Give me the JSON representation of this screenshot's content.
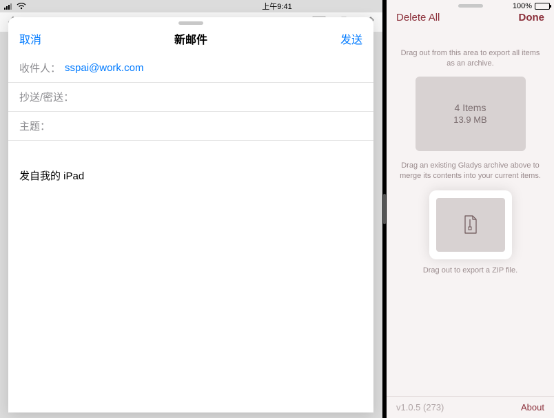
{
  "statusbar": {
    "time": "上午9:41",
    "battery_pct": "100%"
  },
  "compose": {
    "cancel": "取消",
    "title": "新邮件",
    "send": "发送",
    "to_label": "收件人：",
    "to_value": "sspai@work.com",
    "cc_label": "抄送/密送：",
    "subject_label": "主题：",
    "body_text": "发自我的 iPad"
  },
  "right": {
    "delete_all": "Delete All",
    "done": "Done",
    "hint_export": "Drag out from this area to export all items as an archive.",
    "items_count": "4 Items",
    "items_size": "13.9 MB",
    "hint_merge": "Drag an existing Gladys archive above to merge its contents into your current items.",
    "zip_caption": "Drag out to export a ZIP file.",
    "version": "v1.0.5 (273)",
    "about": "About"
  }
}
